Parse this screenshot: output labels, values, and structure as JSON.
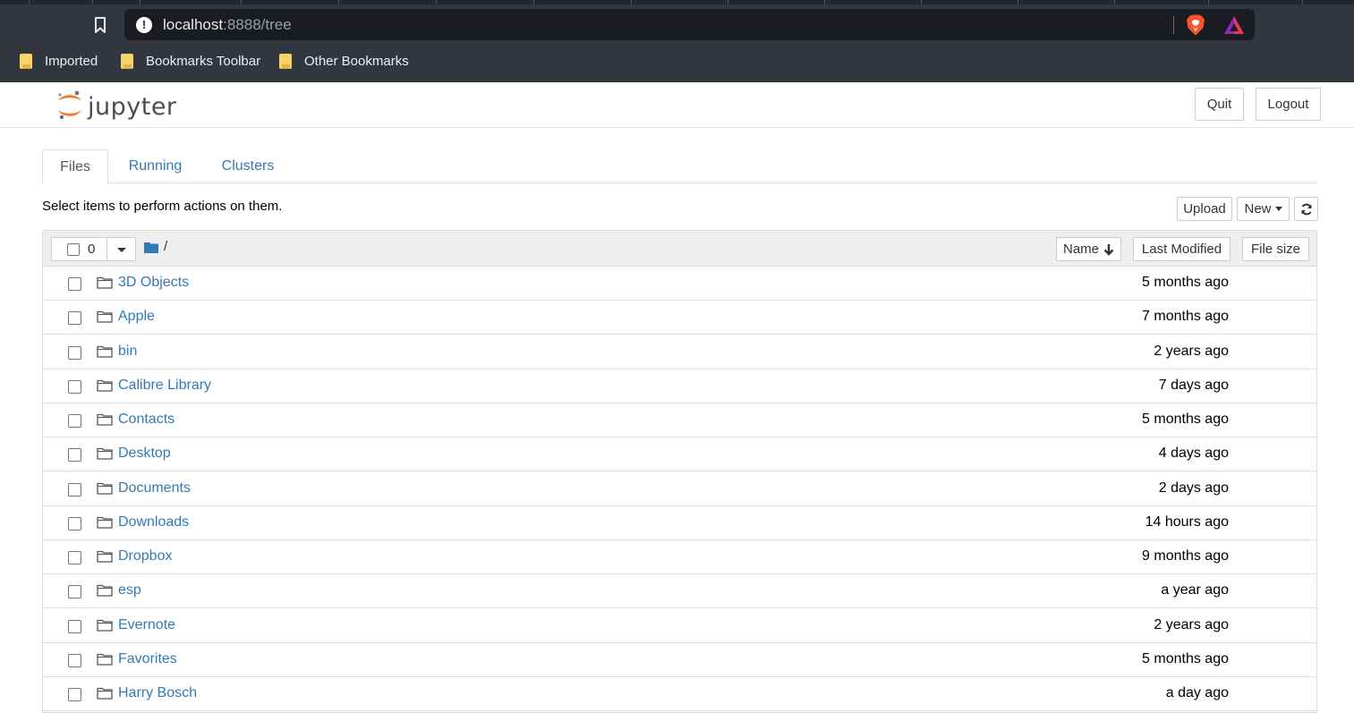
{
  "browser": {
    "url_host": "localhost",
    "url_rest": ":8888/tree",
    "info_glyph": "!",
    "icons": [
      "bookmark-icon",
      "info-icon",
      "brave-shield-icon",
      "brave-rewards-icon"
    ],
    "bookmarks": [
      {
        "label": "Imported"
      },
      {
        "label": "Bookmarks Toolbar"
      },
      {
        "label": "Other Bookmarks"
      }
    ]
  },
  "header": {
    "logo_text": "jupyter",
    "quit_label": "Quit",
    "logout_label": "Logout"
  },
  "tabs": [
    {
      "label": "Files",
      "active": true
    },
    {
      "label": "Running",
      "active": false
    },
    {
      "label": "Clusters",
      "active": false
    }
  ],
  "toolbar": {
    "hint": "Select items to perform actions on them.",
    "upload_label": "Upload",
    "new_label": "New",
    "refresh_icon": "refresh-icon"
  },
  "list_header": {
    "selected_count": "0",
    "breadcrumb_path": "/",
    "sort_name_label": "Name",
    "sort_modified_label": "Last Modified",
    "sort_size_label": "File size"
  },
  "files": [
    {
      "name": "3D Objects",
      "modified": "5 months ago"
    },
    {
      "name": "Apple",
      "modified": "7 months ago"
    },
    {
      "name": "bin",
      "modified": "2 years ago"
    },
    {
      "name": "Calibre Library",
      "modified": "7 days ago"
    },
    {
      "name": "Contacts",
      "modified": "5 months ago"
    },
    {
      "name": "Desktop",
      "modified": "4 days ago"
    },
    {
      "name": "Documents",
      "modified": "2 days ago"
    },
    {
      "name": "Downloads",
      "modified": "14 hours ago"
    },
    {
      "name": "Dropbox",
      "modified": "9 months ago"
    },
    {
      "name": "esp",
      "modified": "a year ago"
    },
    {
      "name": "Evernote",
      "modified": "2 years ago"
    },
    {
      "name": "Favorites",
      "modified": "5 months ago"
    },
    {
      "name": "Harry Bosch",
      "modified": "a day ago"
    }
  ],
  "colors": {
    "link": "#337ab7",
    "chrome_bg": "#32363f",
    "urlbar_bg": "#1a1c21",
    "jupyter_orange": "#f37726"
  }
}
